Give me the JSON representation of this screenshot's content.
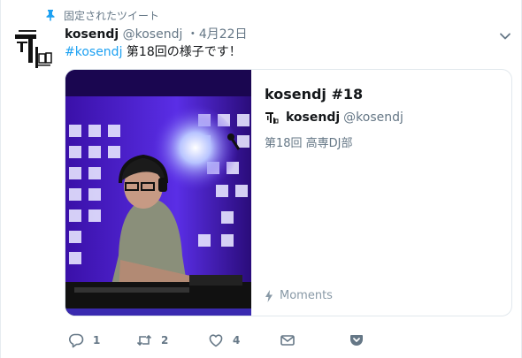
{
  "pinned_label": "固定されたツイート",
  "tweet": {
    "name": "kosendj",
    "handle": "@kosendj",
    "separator": "・",
    "date": "4月22日",
    "hashtag": "#kosendj",
    "text": " 第18回の様子です！"
  },
  "card": {
    "title": "kosendj #18",
    "author_name": "kosendj",
    "author_handle": "@kosendj",
    "description": "第18回 高専DJ部",
    "moments_label": "Moments"
  },
  "actions": {
    "reply_count": "1",
    "retweet_count": "2",
    "like_count": "4"
  },
  "colors": {
    "accent": "#1da1f2",
    "muted": "#657786",
    "pin": "#1da1f2"
  }
}
